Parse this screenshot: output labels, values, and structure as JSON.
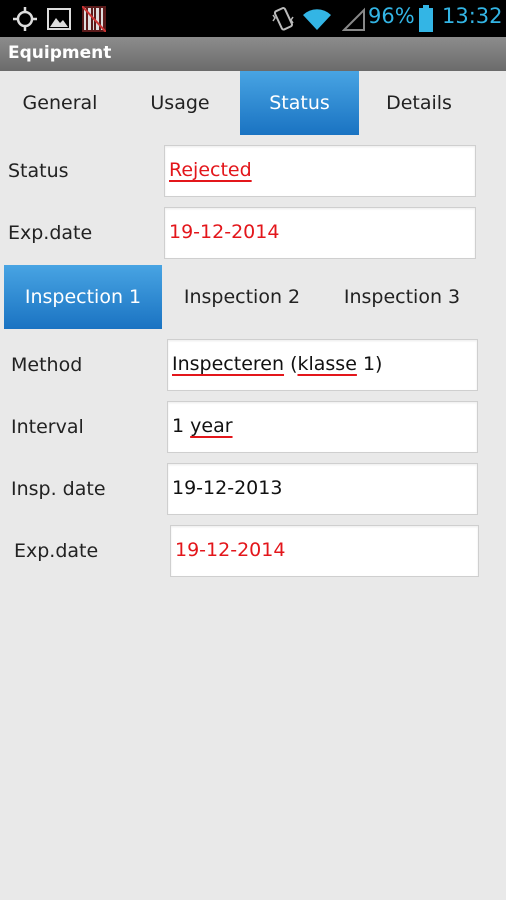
{
  "status_bar": {
    "battery": "96%",
    "time": "13:32",
    "icons": [
      "gps-icon",
      "image-icon",
      "barcode-icon",
      "vibrate-icon",
      "wifi-icon",
      "signal-icon",
      "battery-icon"
    ]
  },
  "action_bar": {
    "title": "Equipment"
  },
  "main_tabs": [
    {
      "label": "General"
    },
    {
      "label": "Usage"
    },
    {
      "label": "Status"
    },
    {
      "label": "Details"
    }
  ],
  "status_section": {
    "status_label": "Status",
    "status_value": "Rejected",
    "exp_label": "Exp.date",
    "exp_value": "19-12-2014"
  },
  "inspection_tabs": [
    {
      "label": "Inspection 1"
    },
    {
      "label": "Inspection 2"
    },
    {
      "label": "Inspection 3"
    }
  ],
  "inspection": {
    "method_label": "Method",
    "method_word1": "Inspecteren",
    "method_word2": "klasse",
    "method_prefix": "(",
    "method_suffix": " 1)",
    "interval_label": "Interval",
    "interval_num": "1 ",
    "interval_unit": "year",
    "insp_date_label": "Insp. date",
    "insp_date_value": "19-12-2013",
    "exp_label": "Exp.date",
    "exp_value": "19-12-2014"
  },
  "colors": {
    "accent": "#33b5e5",
    "tab_active": "#2a86d3",
    "expired_red": "#e3161b"
  }
}
